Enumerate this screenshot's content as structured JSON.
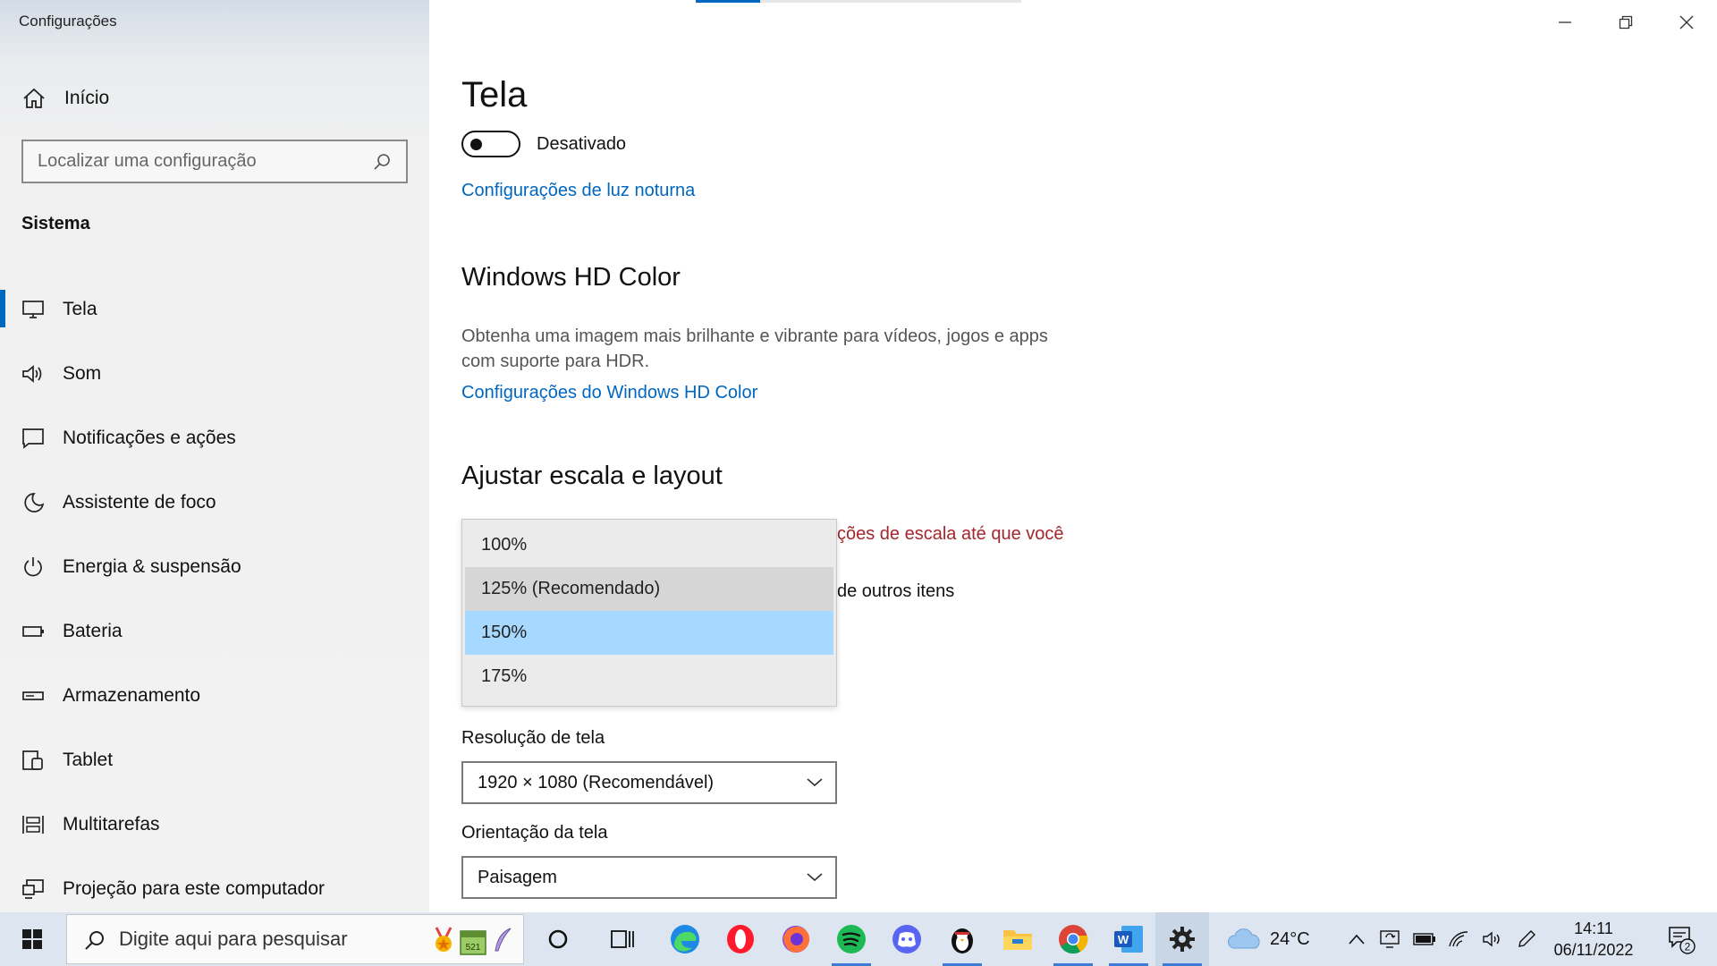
{
  "window": {
    "app_title": "Configurações",
    "controls": [
      "minimize-icon",
      "restore-icon",
      "close-icon"
    ]
  },
  "sidebar": {
    "home_label": "Início",
    "search_placeholder": "Localizar uma configuração",
    "section_title": "Sistema",
    "items": [
      {
        "label": "Tela",
        "icon": "monitor-icon",
        "active": true
      },
      {
        "label": "Som",
        "icon": "speaker-icon"
      },
      {
        "label": "Notificações e ações",
        "icon": "notification-icon"
      },
      {
        "label": "Assistente de foco",
        "icon": "moon-icon"
      },
      {
        "label": "Energia & suspensão",
        "icon": "power-icon"
      },
      {
        "label": "Bateria",
        "icon": "battery-icon"
      },
      {
        "label": "Armazenamento",
        "icon": "storage-icon"
      },
      {
        "label": "Tablet",
        "icon": "tablet-icon"
      },
      {
        "label": "Multitarefas",
        "icon": "multitask-icon"
      },
      {
        "label": "Projeção para este computador",
        "icon": "projection-icon"
      }
    ]
  },
  "main": {
    "title": "Tela",
    "night_light_state": "Desativado",
    "night_light_link": "Configurações de luz noturna",
    "hd_color": {
      "title": "Windows HD Color",
      "description": "Obtenha uma imagem mais brilhante e vibrante para vídeos, jogos e apps com suporte para HDR.",
      "link": "Configurações do Windows HD Color"
    },
    "scale": {
      "title": "Ajustar escala e layout",
      "warning_partial": "ções de escala até que você",
      "behind_partial": "de outros itens",
      "options": [
        "100%",
        "125% (Recomendado)",
        "150%",
        "175%"
      ],
      "selected": "150%"
    },
    "resolution": {
      "label": "Resolução de tela",
      "value": "1920 × 1080 (Recomendável)"
    },
    "orientation": {
      "label": "Orientação da tela",
      "value": "Paisagem"
    }
  },
  "taskbar": {
    "search_placeholder": "Digite aqui para pesquisar",
    "search_badge": "521",
    "weather": "24°C",
    "time": "14:11",
    "date": "06/11/2022",
    "notification_count": "2",
    "pinned": [
      "cortana-icon",
      "task-view-icon",
      "edge-icon",
      "opera-icon",
      "firefox-icon",
      "spotify-icon",
      "discord-icon",
      "penguin-app-icon",
      "file-explorer-icon",
      "chrome-icon",
      "word-icon",
      "settings-icon"
    ]
  },
  "colors": {
    "accent": "#0067c0",
    "warning": "#a4262c",
    "selected_option": "#a7d8ff"
  }
}
